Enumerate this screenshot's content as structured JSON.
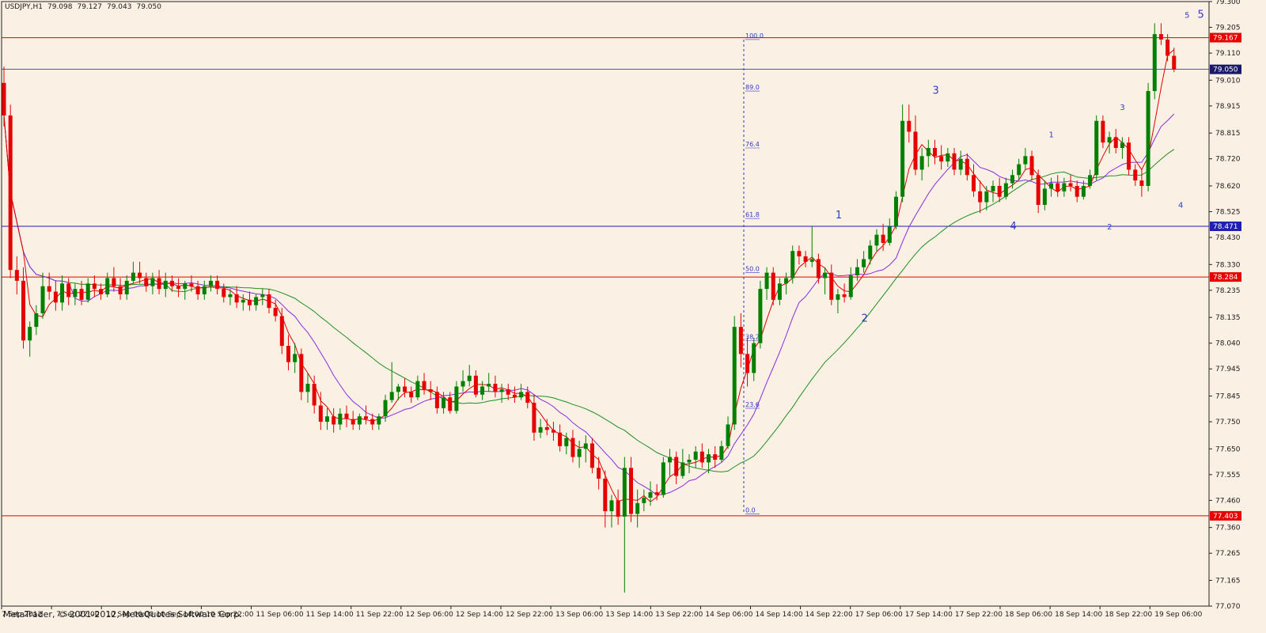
{
  "header": {
    "symbol": "USDJPY,H1",
    "open": "79.098",
    "high": "79.127",
    "low": "79.043",
    "close": "79.050"
  },
  "copyright": "MetaTrader, © 2001-2012, MetaQuotes Software Corp.",
  "colors": {
    "background": "#fbf0e4",
    "bull": "#008000",
    "bear": "#e60000",
    "ma_fast": "#e00000",
    "ma_mid": "#8a2be2",
    "ma_slow": "#1f8f1f",
    "fib": "#2f3cc8",
    "hline_red": "#e60000",
    "hline_blue": "#1f1fb4",
    "wave": "#2f3cc8",
    "axis_text": "#1a1a1a"
  },
  "chart_data": {
    "type": "candlestick",
    "ylim": [
      77.07,
      79.3
    ],
    "y_ticks": [
      "79.300",
      "79.205",
      "79.110",
      "79.010",
      "78.915",
      "78.815",
      "78.720",
      "78.620",
      "78.525",
      "78.430",
      "78.330",
      "78.235",
      "78.135",
      "78.040",
      "77.945",
      "77.845",
      "77.750",
      "77.650",
      "77.555",
      "77.460",
      "77.360",
      "77.265",
      "77.165",
      "77.070"
    ],
    "x_labels": [
      "7 Sep 2012",
      "7 Sep 22:00",
      "10 Sep 06:00",
      "10 Sep 14:00",
      "10 Sep 22:00",
      "11 Sep 06:00",
      "11 Sep 14:00",
      "11 Sep 22:00",
      "12 Sep 06:00",
      "12 Sep 14:00",
      "12 Sep 22:00",
      "13 Sep 06:00",
      "13 Sep 14:00",
      "13 Sep 22:00",
      "14 Sep 06:00",
      "14 Sep 14:00",
      "14 Sep 22:00",
      "17 Sep 06:00",
      "17 Sep 14:00",
      "17 Sep 22:00",
      "18 Sep 06:00",
      "18 Sep 14:00",
      "18 Sep 22:00",
      "19 Sep 06:00"
    ],
    "hlines": [
      {
        "price": 79.167,
        "label": "79.167",
        "color": "red"
      },
      {
        "price": 79.05,
        "label": "79.050",
        "color": "blue_thin"
      },
      {
        "price": 78.471,
        "label": "78.471",
        "color": "blue"
      },
      {
        "price": 78.284,
        "label": "78.284",
        "color": "red"
      },
      {
        "price": 77.403,
        "label": "77.403",
        "color": "red"
      }
    ],
    "fib_levels": [
      {
        "label": "100.0",
        "price": 79.16
      },
      {
        "label": "89.0",
        "price": 78.97
      },
      {
        "label": "76.4",
        "price": 78.76
      },
      {
        "label": "61.8",
        "price": 78.5
      },
      {
        "label": "50.0",
        "price": 78.3
      },
      {
        "label": "38.2",
        "price": 78.05
      },
      {
        "label": "23.6",
        "price": 77.8
      },
      {
        "label": "0.0",
        "price": 77.41
      }
    ],
    "waves": [
      {
        "label": "1",
        "index": 129,
        "price": 78.5
      },
      {
        "label": "2",
        "index": 133,
        "price": 78.12
      },
      {
        "label": "3",
        "index": 144,
        "price": 78.96
      },
      {
        "label": "4",
        "index": 156,
        "price": 78.46
      },
      {
        "label": "1",
        "index": 162,
        "price": 78.8
      },
      {
        "label": "2",
        "index": 171,
        "price": 78.46
      },
      {
        "label": "3",
        "index": 173,
        "price": 78.9
      },
      {
        "label": "4",
        "index": 182,
        "price": 78.54
      },
      {
        "label": "5",
        "index": 183,
        "price": 79.24
      },
      {
        "label": "5",
        "index": 185,
        "price": 79.24
      }
    ],
    "ohlc": [
      [
        79.0,
        79.06,
        78.84,
        78.88
      ],
      [
        78.88,
        78.92,
        78.28,
        78.31
      ],
      [
        78.31,
        78.36,
        78.22,
        78.27
      ],
      [
        78.27,
        78.32,
        78.02,
        78.05
      ],
      [
        78.05,
        78.12,
        77.99,
        78.1
      ],
      [
        78.1,
        78.18,
        78.07,
        78.15
      ],
      [
        78.15,
        78.3,
        78.13,
        78.25
      ],
      [
        78.25,
        78.3,
        78.2,
        78.23
      ],
      [
        78.23,
        78.27,
        78.16,
        78.19
      ],
      [
        78.19,
        78.29,
        78.16,
        78.26
      ],
      [
        78.26,
        78.28,
        78.18,
        78.21
      ],
      [
        78.21,
        78.26,
        78.18,
        78.24
      ],
      [
        78.24,
        78.27,
        78.18,
        78.2
      ],
      [
        78.2,
        78.28,
        78.19,
        78.26
      ],
      [
        78.26,
        78.29,
        78.21,
        78.24
      ],
      [
        78.24,
        78.26,
        78.2,
        78.22
      ],
      [
        78.22,
        78.3,
        78.21,
        78.28
      ],
      [
        78.28,
        78.32,
        78.23,
        78.25
      ],
      [
        78.25,
        78.28,
        78.2,
        78.22
      ],
      [
        78.22,
        78.29,
        78.2,
        78.27
      ],
      [
        78.27,
        78.34,
        78.26,
        78.3
      ],
      [
        78.3,
        78.34,
        78.26,
        78.28
      ],
      [
        78.28,
        78.3,
        78.23,
        78.25
      ],
      [
        78.25,
        78.3,
        78.22,
        78.28
      ],
      [
        78.28,
        78.31,
        78.22,
        78.24
      ],
      [
        78.24,
        78.3,
        78.21,
        78.27
      ],
      [
        78.27,
        78.29,
        78.23,
        78.25
      ],
      [
        78.25,
        78.28,
        78.21,
        78.24
      ],
      [
        78.24,
        78.27,
        78.2,
        78.26
      ],
      [
        78.26,
        78.29,
        78.23,
        78.25
      ],
      [
        78.25,
        78.27,
        78.2,
        78.22
      ],
      [
        78.22,
        78.27,
        78.2,
        78.25
      ],
      [
        78.25,
        78.29,
        78.23,
        78.27
      ],
      [
        78.27,
        78.29,
        78.22,
        78.24
      ],
      [
        78.24,
        78.26,
        78.19,
        78.21
      ],
      [
        78.21,
        78.24,
        78.18,
        78.22
      ],
      [
        78.22,
        78.25,
        78.17,
        78.19
      ],
      [
        78.19,
        78.22,
        78.16,
        78.2
      ],
      [
        78.2,
        78.23,
        78.16,
        78.18
      ],
      [
        78.18,
        78.22,
        78.16,
        78.21
      ],
      [
        78.21,
        78.24,
        78.18,
        78.22
      ],
      [
        78.22,
        78.24,
        78.15,
        78.17
      ],
      [
        78.17,
        78.2,
        78.12,
        78.14
      ],
      [
        78.14,
        78.17,
        78.0,
        78.03
      ],
      [
        78.03,
        78.07,
        77.94,
        77.97
      ],
      [
        77.97,
        78.04,
        77.93,
        78.0
      ],
      [
        78.0,
        78.02,
        77.83,
        77.86
      ],
      [
        77.86,
        77.93,
        77.82,
        77.89
      ],
      [
        77.89,
        77.92,
        77.78,
        77.81
      ],
      [
        77.81,
        77.86,
        77.72,
        77.75
      ],
      [
        77.75,
        77.8,
        77.72,
        77.77
      ],
      [
        77.77,
        77.8,
        77.71,
        77.74
      ],
      [
        77.74,
        77.8,
        77.72,
        77.78
      ],
      [
        77.78,
        77.81,
        77.73,
        77.76
      ],
      [
        77.76,
        77.79,
        77.72,
        77.74
      ],
      [
        77.74,
        77.78,
        77.72,
        77.77
      ],
      [
        77.77,
        77.81,
        77.74,
        77.76
      ],
      [
        77.76,
        77.78,
        77.72,
        77.74
      ],
      [
        77.74,
        77.78,
        77.72,
        77.77
      ],
      [
        77.77,
        77.85,
        77.75,
        77.83
      ],
      [
        77.83,
        77.97,
        77.82,
        77.86
      ],
      [
        77.86,
        77.89,
        77.83,
        77.88
      ],
      [
        77.88,
        77.91,
        77.84,
        77.86
      ],
      [
        77.86,
        77.88,
        77.82,
        77.84
      ],
      [
        77.84,
        77.92,
        77.83,
        77.9
      ],
      [
        77.9,
        77.93,
        77.85,
        77.87
      ],
      [
        77.87,
        77.9,
        77.83,
        77.86
      ],
      [
        77.86,
        77.88,
        77.78,
        77.8
      ],
      [
        77.8,
        77.86,
        77.78,
        77.84
      ],
      [
        77.84,
        77.86,
        77.78,
        77.79
      ],
      [
        77.79,
        77.9,
        77.78,
        77.88
      ],
      [
        77.88,
        77.94,
        77.86,
        77.9
      ],
      [
        77.9,
        77.96,
        77.88,
        77.92
      ],
      [
        77.92,
        77.94,
        77.84,
        77.85
      ],
      [
        77.85,
        77.9,
        77.83,
        77.88
      ],
      [
        77.88,
        77.93,
        77.86,
        77.89
      ],
      [
        77.89,
        77.92,
        77.84,
        77.86
      ],
      [
        77.86,
        77.89,
        77.82,
        77.87
      ],
      [
        77.87,
        77.89,
        77.83,
        77.85
      ],
      [
        77.85,
        77.88,
        77.82,
        77.84
      ],
      [
        77.84,
        77.89,
        77.83,
        77.86
      ],
      [
        77.86,
        77.88,
        77.8,
        77.82
      ],
      [
        77.82,
        77.85,
        77.68,
        77.71
      ],
      [
        77.71,
        77.76,
        77.69,
        77.73
      ],
      [
        77.73,
        77.76,
        77.7,
        77.72
      ],
      [
        77.72,
        77.75,
        77.68,
        77.71
      ],
      [
        77.71,
        77.74,
        77.64,
        77.66
      ],
      [
        77.66,
        77.71,
        77.63,
        77.69
      ],
      [
        77.69,
        77.72,
        77.6,
        77.62
      ],
      [
        77.62,
        77.68,
        77.58,
        77.65
      ],
      [
        77.65,
        77.7,
        77.6,
        77.67
      ],
      [
        77.67,
        77.69,
        77.56,
        77.58
      ],
      [
        77.58,
        77.62,
        77.5,
        77.54
      ],
      [
        77.54,
        77.57,
        77.36,
        77.42
      ],
      [
        77.42,
        77.48,
        77.36,
        77.46
      ],
      [
        77.46,
        77.5,
        77.37,
        77.4
      ],
      [
        77.4,
        77.62,
        77.12,
        77.58
      ],
      [
        77.58,
        77.62,
        77.38,
        77.41
      ],
      [
        77.41,
        77.5,
        77.36,
        77.45
      ],
      [
        77.45,
        77.5,
        77.42,
        77.47
      ],
      [
        77.47,
        77.53,
        77.44,
        77.49
      ],
      [
        77.49,
        77.52,
        77.46,
        77.48
      ],
      [
        77.48,
        77.62,
        77.47,
        77.6
      ],
      [
        77.6,
        77.65,
        77.55,
        77.62
      ],
      [
        77.62,
        77.64,
        77.52,
        77.55
      ],
      [
        77.55,
        77.65,
        77.54,
        77.6
      ],
      [
        77.6,
        77.63,
        77.56,
        77.61
      ],
      [
        77.61,
        77.66,
        77.58,
        77.64
      ],
      [
        77.64,
        77.67,
        77.58,
        77.6
      ],
      [
        77.6,
        77.65,
        77.56,
        77.63
      ],
      [
        77.63,
        77.66,
        77.58,
        77.61
      ],
      [
        77.61,
        77.68,
        77.6,
        77.66
      ],
      [
        77.66,
        77.77,
        77.65,
        77.74
      ],
      [
        77.74,
        78.14,
        77.72,
        78.1
      ],
      [
        78.1,
        78.15,
        77.95,
        78.0
      ],
      [
        78.0,
        78.06,
        77.88,
        77.93
      ],
      [
        77.93,
        78.06,
        77.9,
        78.04
      ],
      [
        78.04,
        78.27,
        78.02,
        78.24
      ],
      [
        78.24,
        78.32,
        78.2,
        78.3
      ],
      [
        78.3,
        78.32,
        78.18,
        78.2
      ],
      [
        78.2,
        78.28,
        78.18,
        78.26
      ],
      [
        78.26,
        78.3,
        78.22,
        78.28
      ],
      [
        78.28,
        78.4,
        78.26,
        78.38
      ],
      [
        78.38,
        78.4,
        78.33,
        78.36
      ],
      [
        78.36,
        78.38,
        78.32,
        78.34
      ],
      [
        78.34,
        78.47,
        78.32,
        78.35
      ],
      [
        78.35,
        78.37,
        78.26,
        78.28
      ],
      [
        78.28,
        78.32,
        78.22,
        78.3
      ],
      [
        78.3,
        78.33,
        78.18,
        78.2
      ],
      [
        78.2,
        78.24,
        78.15,
        78.22
      ],
      [
        78.22,
        78.26,
        78.19,
        78.21
      ],
      [
        78.21,
        78.32,
        78.2,
        78.29
      ],
      [
        78.29,
        78.35,
        78.27,
        78.32
      ],
      [
        78.32,
        78.38,
        78.3,
        78.35
      ],
      [
        78.35,
        78.42,
        78.33,
        78.4
      ],
      [
        78.4,
        78.46,
        78.38,
        78.44
      ],
      [
        78.44,
        78.48,
        78.38,
        78.41
      ],
      [
        78.41,
        78.5,
        78.4,
        78.47
      ],
      [
        78.47,
        78.6,
        78.46,
        78.58
      ],
      [
        78.58,
        78.92,
        78.56,
        78.86
      ],
      [
        78.86,
        78.92,
        78.78,
        78.82
      ],
      [
        78.82,
        78.88,
        78.66,
        78.68
      ],
      [
        78.68,
        78.76,
        78.64,
        78.73
      ],
      [
        78.73,
        78.79,
        78.69,
        78.76
      ],
      [
        78.76,
        78.79,
        78.7,
        78.73
      ],
      [
        78.73,
        78.77,
        78.68,
        78.71
      ],
      [
        78.71,
        78.76,
        78.69,
        78.74
      ],
      [
        78.74,
        78.76,
        78.66,
        78.68
      ],
      [
        78.68,
        78.75,
        78.66,
        78.72
      ],
      [
        78.72,
        78.74,
        78.64,
        78.66
      ],
      [
        78.66,
        78.7,
        78.58,
        78.6
      ],
      [
        78.6,
        78.64,
        78.52,
        78.56
      ],
      [
        78.56,
        78.62,
        78.53,
        78.6
      ],
      [
        78.6,
        78.64,
        78.56,
        78.62
      ],
      [
        78.62,
        78.65,
        78.56,
        78.58
      ],
      [
        78.58,
        78.65,
        78.57,
        78.63
      ],
      [
        78.63,
        78.68,
        78.61,
        78.66
      ],
      [
        78.66,
        78.72,
        78.64,
        78.7
      ],
      [
        78.7,
        78.76,
        78.68,
        78.73
      ],
      [
        78.73,
        78.75,
        78.64,
        78.66
      ],
      [
        78.66,
        78.68,
        78.52,
        78.55
      ],
      [
        78.55,
        78.64,
        78.53,
        78.61
      ],
      [
        78.61,
        78.65,
        78.58,
        78.63
      ],
      [
        78.63,
        78.66,
        78.58,
        78.6
      ],
      [
        78.6,
        78.65,
        78.58,
        78.63
      ],
      [
        78.63,
        78.66,
        78.6,
        78.62
      ],
      [
        78.62,
        78.64,
        78.56,
        78.58
      ],
      [
        78.58,
        78.64,
        78.57,
        78.62
      ],
      [
        78.62,
        78.68,
        78.61,
        78.66
      ],
      [
        78.66,
        78.88,
        78.64,
        78.86
      ],
      [
        78.86,
        78.88,
        78.76,
        78.78
      ],
      [
        78.78,
        78.82,
        78.74,
        78.8
      ],
      [
        78.8,
        78.83,
        78.74,
        78.76
      ],
      [
        78.76,
        78.8,
        78.72,
        78.78
      ],
      [
        78.78,
        78.8,
        78.66,
        78.68
      ],
      [
        78.68,
        78.7,
        78.62,
        78.64
      ],
      [
        78.64,
        78.68,
        78.58,
        78.62
      ],
      [
        78.62,
        79.0,
        78.6,
        78.97
      ],
      [
        78.97,
        79.22,
        78.94,
        79.18
      ],
      [
        79.18,
        79.22,
        79.14,
        79.16
      ],
      [
        79.16,
        79.18,
        79.08,
        79.1
      ],
      [
        79.1,
        79.13,
        79.04,
        79.05
      ]
    ]
  }
}
